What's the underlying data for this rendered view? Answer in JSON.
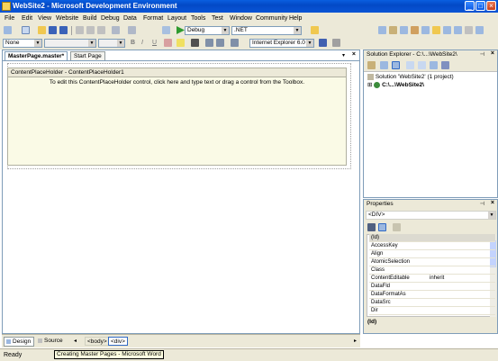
{
  "window": {
    "title": "WebSite2 - Microsoft Development Environment"
  },
  "menu": [
    "File",
    "Edit",
    "View",
    "Website",
    "Build",
    "Debug",
    "Data",
    "Format",
    "Layout",
    "Tools",
    "Test",
    "Window",
    "Community",
    "Help"
  ],
  "toolbar1": {
    "config_value": "Debug",
    "platform_value": ".NET"
  },
  "toolbar2": {
    "block_format": "None",
    "browser_target": "Internet Explorer 6.0"
  },
  "editor": {
    "tabs": [
      "MasterPage.master*",
      "Start Page"
    ],
    "placeholder_header": "ContentPlaceHolder - ContentPlaceHolder1",
    "placeholder_hint": "To edit this ContentPlaceHolder control, click here and type text or drag a control from the Toolbox."
  },
  "solution_explorer": {
    "title": "Solution Explorer - C:\\...\\WebSite2\\",
    "solution": "Solution 'WebSite2' (1 project)",
    "project": "C:\\...\\WebSite2\\"
  },
  "properties": {
    "title": "Properties",
    "selected_object": "<DIV>",
    "rows": [
      {
        "key": "(Id)",
        "value": ""
      },
      {
        "key": "AccessKey",
        "value": ""
      },
      {
        "key": "Align",
        "value": ""
      },
      {
        "key": "AtomicSelection",
        "value": ""
      },
      {
        "key": "Class",
        "value": ""
      },
      {
        "key": "ContentEditable",
        "value": "inherit"
      },
      {
        "key": "DataFld",
        "value": ""
      },
      {
        "key": "DataFormatAs",
        "value": ""
      },
      {
        "key": "DataSrc",
        "value": ""
      },
      {
        "key": "Dir",
        "value": ""
      }
    ],
    "description_title": "(Id)"
  },
  "bottom": {
    "design_tab": "Design",
    "source_tab": "Source",
    "tag_body": "<body>",
    "tag_div": "<div>"
  },
  "status": {
    "text": "Ready",
    "tooltip": "Creating Master Pages - Microsoft Word"
  }
}
